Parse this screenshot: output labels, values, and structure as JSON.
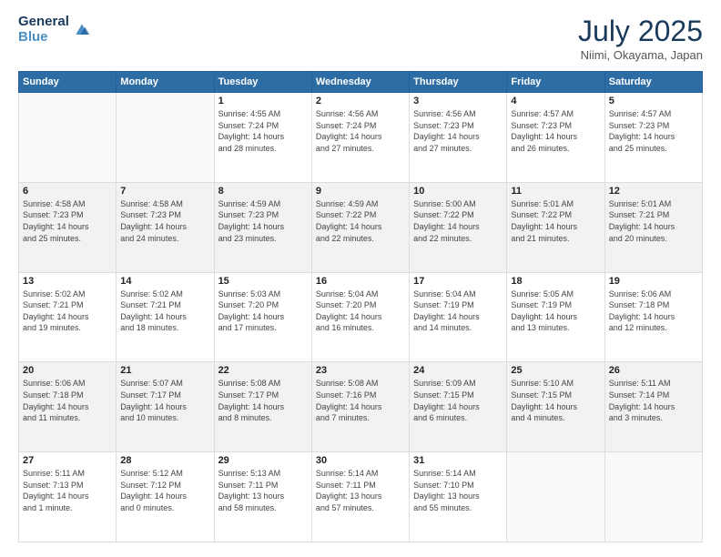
{
  "header": {
    "logo_line1": "General",
    "logo_line2": "Blue",
    "month_title": "July 2025",
    "location": "Niimi, Okayama, Japan"
  },
  "weekdays": [
    "Sunday",
    "Monday",
    "Tuesday",
    "Wednesday",
    "Thursday",
    "Friday",
    "Saturday"
  ],
  "weeks": [
    [
      {
        "day": "",
        "lines": [],
        "empty": true
      },
      {
        "day": "",
        "lines": [],
        "empty": true
      },
      {
        "day": "1",
        "lines": [
          "Sunrise: 4:55 AM",
          "Sunset: 7:24 PM",
          "Daylight: 14 hours",
          "and 28 minutes."
        ]
      },
      {
        "day": "2",
        "lines": [
          "Sunrise: 4:56 AM",
          "Sunset: 7:24 PM",
          "Daylight: 14 hours",
          "and 27 minutes."
        ]
      },
      {
        "day": "3",
        "lines": [
          "Sunrise: 4:56 AM",
          "Sunset: 7:23 PM",
          "Daylight: 14 hours",
          "and 27 minutes."
        ]
      },
      {
        "day": "4",
        "lines": [
          "Sunrise: 4:57 AM",
          "Sunset: 7:23 PM",
          "Daylight: 14 hours",
          "and 26 minutes."
        ]
      },
      {
        "day": "5",
        "lines": [
          "Sunrise: 4:57 AM",
          "Sunset: 7:23 PM",
          "Daylight: 14 hours",
          "and 25 minutes."
        ]
      }
    ],
    [
      {
        "day": "6",
        "lines": [
          "Sunrise: 4:58 AM",
          "Sunset: 7:23 PM",
          "Daylight: 14 hours",
          "and 25 minutes."
        ]
      },
      {
        "day": "7",
        "lines": [
          "Sunrise: 4:58 AM",
          "Sunset: 7:23 PM",
          "Daylight: 14 hours",
          "and 24 minutes."
        ]
      },
      {
        "day": "8",
        "lines": [
          "Sunrise: 4:59 AM",
          "Sunset: 7:23 PM",
          "Daylight: 14 hours",
          "and 23 minutes."
        ]
      },
      {
        "day": "9",
        "lines": [
          "Sunrise: 4:59 AM",
          "Sunset: 7:22 PM",
          "Daylight: 14 hours",
          "and 22 minutes."
        ]
      },
      {
        "day": "10",
        "lines": [
          "Sunrise: 5:00 AM",
          "Sunset: 7:22 PM",
          "Daylight: 14 hours",
          "and 22 minutes."
        ]
      },
      {
        "day": "11",
        "lines": [
          "Sunrise: 5:01 AM",
          "Sunset: 7:22 PM",
          "Daylight: 14 hours",
          "and 21 minutes."
        ]
      },
      {
        "day": "12",
        "lines": [
          "Sunrise: 5:01 AM",
          "Sunset: 7:21 PM",
          "Daylight: 14 hours",
          "and 20 minutes."
        ]
      }
    ],
    [
      {
        "day": "13",
        "lines": [
          "Sunrise: 5:02 AM",
          "Sunset: 7:21 PM",
          "Daylight: 14 hours",
          "and 19 minutes."
        ]
      },
      {
        "day": "14",
        "lines": [
          "Sunrise: 5:02 AM",
          "Sunset: 7:21 PM",
          "Daylight: 14 hours",
          "and 18 minutes."
        ]
      },
      {
        "day": "15",
        "lines": [
          "Sunrise: 5:03 AM",
          "Sunset: 7:20 PM",
          "Daylight: 14 hours",
          "and 17 minutes."
        ]
      },
      {
        "day": "16",
        "lines": [
          "Sunrise: 5:04 AM",
          "Sunset: 7:20 PM",
          "Daylight: 14 hours",
          "and 16 minutes."
        ]
      },
      {
        "day": "17",
        "lines": [
          "Sunrise: 5:04 AM",
          "Sunset: 7:19 PM",
          "Daylight: 14 hours",
          "and 14 minutes."
        ]
      },
      {
        "day": "18",
        "lines": [
          "Sunrise: 5:05 AM",
          "Sunset: 7:19 PM",
          "Daylight: 14 hours",
          "and 13 minutes."
        ]
      },
      {
        "day": "19",
        "lines": [
          "Sunrise: 5:06 AM",
          "Sunset: 7:18 PM",
          "Daylight: 14 hours",
          "and 12 minutes."
        ]
      }
    ],
    [
      {
        "day": "20",
        "lines": [
          "Sunrise: 5:06 AM",
          "Sunset: 7:18 PM",
          "Daylight: 14 hours",
          "and 11 minutes."
        ]
      },
      {
        "day": "21",
        "lines": [
          "Sunrise: 5:07 AM",
          "Sunset: 7:17 PM",
          "Daylight: 14 hours",
          "and 10 minutes."
        ]
      },
      {
        "day": "22",
        "lines": [
          "Sunrise: 5:08 AM",
          "Sunset: 7:17 PM",
          "Daylight: 14 hours",
          "and 8 minutes."
        ]
      },
      {
        "day": "23",
        "lines": [
          "Sunrise: 5:08 AM",
          "Sunset: 7:16 PM",
          "Daylight: 14 hours",
          "and 7 minutes."
        ]
      },
      {
        "day": "24",
        "lines": [
          "Sunrise: 5:09 AM",
          "Sunset: 7:15 PM",
          "Daylight: 14 hours",
          "and 6 minutes."
        ]
      },
      {
        "day": "25",
        "lines": [
          "Sunrise: 5:10 AM",
          "Sunset: 7:15 PM",
          "Daylight: 14 hours",
          "and 4 minutes."
        ]
      },
      {
        "day": "26",
        "lines": [
          "Sunrise: 5:11 AM",
          "Sunset: 7:14 PM",
          "Daylight: 14 hours",
          "and 3 minutes."
        ]
      }
    ],
    [
      {
        "day": "27",
        "lines": [
          "Sunrise: 5:11 AM",
          "Sunset: 7:13 PM",
          "Daylight: 14 hours",
          "and 1 minute."
        ]
      },
      {
        "day": "28",
        "lines": [
          "Sunrise: 5:12 AM",
          "Sunset: 7:12 PM",
          "Daylight: 14 hours",
          "and 0 minutes."
        ]
      },
      {
        "day": "29",
        "lines": [
          "Sunrise: 5:13 AM",
          "Sunset: 7:11 PM",
          "Daylight: 13 hours",
          "and 58 minutes."
        ]
      },
      {
        "day": "30",
        "lines": [
          "Sunrise: 5:14 AM",
          "Sunset: 7:11 PM",
          "Daylight: 13 hours",
          "and 57 minutes."
        ]
      },
      {
        "day": "31",
        "lines": [
          "Sunrise: 5:14 AM",
          "Sunset: 7:10 PM",
          "Daylight: 13 hours",
          "and 55 minutes."
        ]
      },
      {
        "day": "",
        "lines": [],
        "empty": true
      },
      {
        "day": "",
        "lines": [],
        "empty": true
      }
    ]
  ]
}
